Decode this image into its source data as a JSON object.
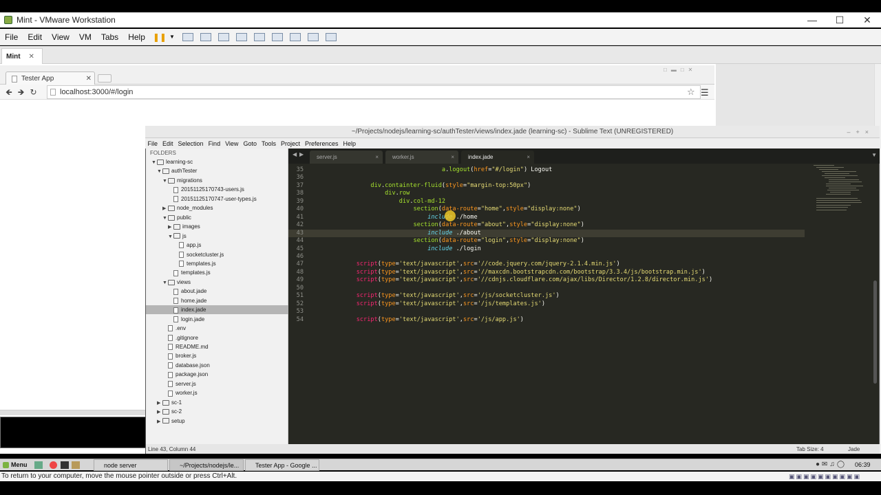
{
  "vmware": {
    "title": "Mint - VMware Workstation",
    "menu": [
      "File",
      "Edit",
      "View",
      "VM",
      "Tabs",
      "Help"
    ],
    "tab": "Mint",
    "status_hint": "To return to your computer, move the mouse pointer outside or press Ctrl+Alt."
  },
  "chrome": {
    "tab_title": "Tester App",
    "url": "localhost:3000/#/login"
  },
  "sublime": {
    "title": "~/Projects/nodejs/learning-sc/authTester/views/index.jade (learning-sc) - Sublime Text (UNREGISTERED)",
    "menu": [
      "File",
      "Edit",
      "Selection",
      "Find",
      "View",
      "Goto",
      "Tools",
      "Project",
      "Preferences",
      "Help"
    ],
    "sidebar_header": "FOLDERS",
    "tree": [
      {
        "label": "learning-sc",
        "kind": "folder",
        "depth": 0,
        "open": true
      },
      {
        "label": "authTester",
        "kind": "folder",
        "depth": 1,
        "open": true
      },
      {
        "label": "migrations",
        "kind": "folder",
        "depth": 2,
        "open": true
      },
      {
        "label": "20151125170743-users.js",
        "kind": "file",
        "depth": 3
      },
      {
        "label": "20151125170747-user-types.js",
        "kind": "file",
        "depth": 3
      },
      {
        "label": "node_modules",
        "kind": "folder",
        "depth": 2,
        "open": false
      },
      {
        "label": "public",
        "kind": "folder",
        "depth": 2,
        "open": true
      },
      {
        "label": "images",
        "kind": "folder",
        "depth": 3,
        "open": false
      },
      {
        "label": "js",
        "kind": "folder",
        "depth": 3,
        "open": true
      },
      {
        "label": "app.js",
        "kind": "file",
        "depth": 4
      },
      {
        "label": "socketcluster.js",
        "kind": "file",
        "depth": 4
      },
      {
        "label": "templates.js",
        "kind": "file",
        "depth": 4
      },
      {
        "label": "templates.js",
        "kind": "file",
        "depth": 3
      },
      {
        "label": "views",
        "kind": "folder",
        "depth": 2,
        "open": true
      },
      {
        "label": "about.jade",
        "kind": "file",
        "depth": 3
      },
      {
        "label": "home.jade",
        "kind": "file",
        "depth": 3
      },
      {
        "label": "index.jade",
        "kind": "file",
        "depth": 3,
        "selected": true
      },
      {
        "label": "login.jade",
        "kind": "file",
        "depth": 3
      },
      {
        "label": ".env",
        "kind": "file",
        "depth": 2
      },
      {
        "label": ".gitignore",
        "kind": "file",
        "depth": 2
      },
      {
        "label": "README.md",
        "kind": "file",
        "depth": 2
      },
      {
        "label": "broker.js",
        "kind": "file",
        "depth": 2
      },
      {
        "label": "database.json",
        "kind": "file",
        "depth": 2
      },
      {
        "label": "package.json",
        "kind": "file",
        "depth": 2
      },
      {
        "label": "server.js",
        "kind": "file",
        "depth": 2
      },
      {
        "label": "worker.js",
        "kind": "file",
        "depth": 2
      },
      {
        "label": "sc-1",
        "kind": "folder",
        "depth": 1,
        "open": false
      },
      {
        "label": "sc-2",
        "kind": "folder",
        "depth": 1,
        "open": false
      },
      {
        "label": "setup",
        "kind": "folder",
        "depth": 1,
        "open": false
      }
    ],
    "tabs": [
      {
        "label": "server.js",
        "active": false
      },
      {
        "label": "worker.js",
        "active": false
      },
      {
        "label": "index.jade",
        "active": true
      }
    ],
    "lines": [
      {
        "n": "35",
        "tokens": [
          [
            "",
            "                            "
          ],
          [
            "t",
            "a"
          ],
          [
            "",
            "."
          ],
          [
            "t",
            "logout"
          ],
          [
            "",
            "("
          ],
          [
            "a",
            "href"
          ],
          [
            "",
            "="
          ],
          [
            "s",
            "\"#/login\""
          ],
          [
            "",
            ") Logout"
          ]
        ]
      },
      {
        "n": "36",
        "tokens": []
      },
      {
        "n": "37",
        "tokens": [
          [
            "",
            "        "
          ],
          [
            "t",
            "div"
          ],
          [
            "",
            "."
          ],
          [
            "t",
            "containter-fluid"
          ],
          [
            "",
            "("
          ],
          [
            "a",
            "style"
          ],
          [
            "",
            "="
          ],
          [
            "s",
            "\"margin-top:50px\""
          ],
          [
            "",
            ")"
          ]
        ]
      },
      {
        "n": "38",
        "tokens": [
          [
            "",
            "            "
          ],
          [
            "t",
            "div"
          ],
          [
            "",
            "."
          ],
          [
            "t",
            "row"
          ]
        ]
      },
      {
        "n": "39",
        "tokens": [
          [
            "",
            "                "
          ],
          [
            "t",
            "div"
          ],
          [
            "",
            "."
          ],
          [
            "t",
            "col-md-12"
          ]
        ]
      },
      {
        "n": "40",
        "tokens": [
          [
            "",
            "                    "
          ],
          [
            "t",
            "section"
          ],
          [
            "",
            "("
          ],
          [
            "a",
            "data-route"
          ],
          [
            "",
            "="
          ],
          [
            "s",
            "\"home\""
          ],
          [
            "",
            ","
          ],
          [
            "a",
            "style"
          ],
          [
            "",
            "="
          ],
          [
            "s",
            "\"display:none\""
          ],
          [
            "",
            ")"
          ]
        ]
      },
      {
        "n": "41",
        "tokens": [
          [
            "",
            "                        "
          ],
          [
            "i",
            "include"
          ],
          [
            "",
            " ./home"
          ]
        ]
      },
      {
        "n": "42",
        "tokens": [
          [
            "",
            "                    "
          ],
          [
            "t",
            "section"
          ],
          [
            "",
            "("
          ],
          [
            "a",
            "data-route"
          ],
          [
            "",
            "="
          ],
          [
            "s",
            "\"about\""
          ],
          [
            "",
            ","
          ],
          [
            "a",
            "style"
          ],
          [
            "",
            "="
          ],
          [
            "s",
            "\"display:none\""
          ],
          [
            "",
            ")"
          ]
        ]
      },
      {
        "n": "43",
        "tokens": [
          [
            "",
            "                        "
          ],
          [
            "i",
            "include"
          ],
          [
            "",
            " ./about"
          ]
        ],
        "current": true
      },
      {
        "n": "44",
        "tokens": [
          [
            "",
            "                    "
          ],
          [
            "t",
            "section"
          ],
          [
            "",
            "("
          ],
          [
            "a",
            "data-route"
          ],
          [
            "",
            "="
          ],
          [
            "s",
            "\"login\""
          ],
          [
            "",
            ","
          ],
          [
            "a",
            "style"
          ],
          [
            "",
            "="
          ],
          [
            "s",
            "\"display:none\""
          ],
          [
            "",
            ")"
          ]
        ]
      },
      {
        "n": "45",
        "tokens": [
          [
            "",
            "                        "
          ],
          [
            "i",
            "include"
          ],
          [
            "",
            " ./login"
          ]
        ]
      },
      {
        "n": "46",
        "tokens": []
      },
      {
        "n": "47",
        "tokens": [
          [
            "",
            "    "
          ],
          [
            "k",
            "script"
          ],
          [
            "",
            "("
          ],
          [
            "a",
            "type"
          ],
          [
            "",
            "="
          ],
          [
            "s",
            "'text/javascript'"
          ],
          [
            "",
            ","
          ],
          [
            "a",
            "src"
          ],
          [
            "",
            "="
          ],
          [
            "s",
            "'//code.jquery.com/jquery-2.1.4.min.js'"
          ],
          [
            "",
            ")"
          ]
        ]
      },
      {
        "n": "48",
        "tokens": [
          [
            "",
            "    "
          ],
          [
            "k",
            "script"
          ],
          [
            "",
            "("
          ],
          [
            "a",
            "type"
          ],
          [
            "",
            "="
          ],
          [
            "s",
            "'text/javascript'"
          ],
          [
            "",
            ","
          ],
          [
            "a",
            "src"
          ],
          [
            "",
            "="
          ],
          [
            "s",
            "'//maxcdn.bootstrapcdn.com/bootstrap/3.3.4/js/bootstrap.min.js'"
          ],
          [
            "",
            ")"
          ]
        ]
      },
      {
        "n": "49",
        "tokens": [
          [
            "",
            "    "
          ],
          [
            "k",
            "script"
          ],
          [
            "",
            "("
          ],
          [
            "a",
            "type"
          ],
          [
            "",
            "="
          ],
          [
            "s",
            "'text/javascript'"
          ],
          [
            "",
            ","
          ],
          [
            "a",
            "src"
          ],
          [
            "",
            "="
          ],
          [
            "s",
            "'//cdnjs.cloudflare.com/ajax/libs/Director/1.2.8/director.min.js'"
          ],
          [
            "",
            ")"
          ]
        ]
      },
      {
        "n": "50",
        "tokens": []
      },
      {
        "n": "51",
        "tokens": [
          [
            "",
            "    "
          ],
          [
            "k",
            "script"
          ],
          [
            "",
            "("
          ],
          [
            "a",
            "type"
          ],
          [
            "",
            "="
          ],
          [
            "s",
            "'text/javascript'"
          ],
          [
            "",
            ","
          ],
          [
            "a",
            "src"
          ],
          [
            "",
            "="
          ],
          [
            "s",
            "'/js/socketcluster.js'"
          ],
          [
            "",
            ")"
          ]
        ]
      },
      {
        "n": "52",
        "tokens": [
          [
            "",
            "    "
          ],
          [
            "k",
            "script"
          ],
          [
            "",
            "("
          ],
          [
            "a",
            "type"
          ],
          [
            "",
            "="
          ],
          [
            "s",
            "'text/javascript'"
          ],
          [
            "",
            ","
          ],
          [
            "a",
            "src"
          ],
          [
            "",
            "="
          ],
          [
            "s",
            "'/js/templates.js'"
          ],
          [
            "",
            ")"
          ]
        ]
      },
      {
        "n": "53",
        "tokens": []
      },
      {
        "n": "54",
        "tokens": [
          [
            "",
            "    "
          ],
          [
            "k",
            "script"
          ],
          [
            "",
            "("
          ],
          [
            "a",
            "type"
          ],
          [
            "",
            "="
          ],
          [
            "s",
            "'text/javascript'"
          ],
          [
            "",
            ","
          ],
          [
            "a",
            "src"
          ],
          [
            "",
            "="
          ],
          [
            "s",
            "'/js/app.js'"
          ],
          [
            "",
            ")"
          ]
        ]
      }
    ],
    "status_left": "Line 43, Column 44",
    "tab_size": "Tab Size: 4",
    "syntax": "Jade"
  },
  "panel": {
    "menu": "Menu",
    "tasks": [
      "node server",
      "~/Projects/nodejs/le...",
      "Tester App - Google ..."
    ],
    "clock": "06:39"
  }
}
